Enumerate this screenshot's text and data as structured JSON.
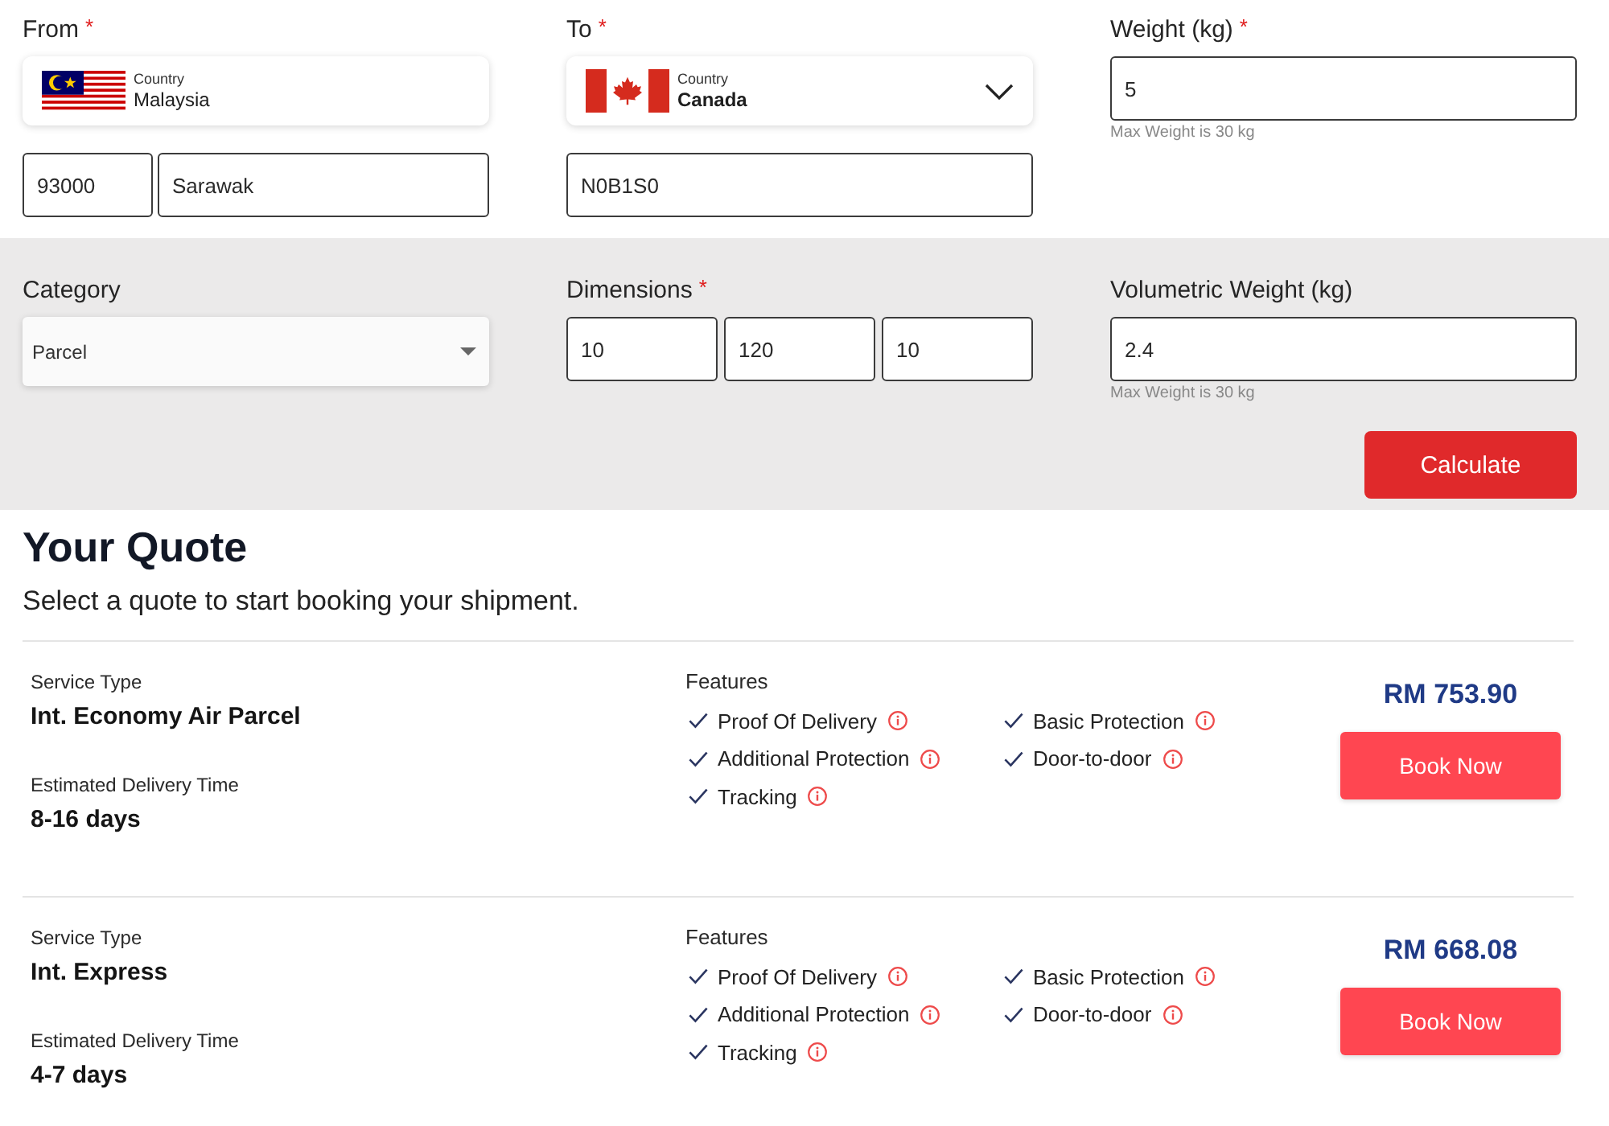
{
  "from": {
    "label": "From",
    "required_mark": "*",
    "country_caption": "Country",
    "country": "Malaysia",
    "dropdown": false,
    "postcode": "93000",
    "state": "Sarawak"
  },
  "to": {
    "label": "To",
    "required_mark": "*",
    "country_caption": "Country",
    "country": "Canada",
    "dropdown": true,
    "postcode": "N0B1S0"
  },
  "weight": {
    "label": "Weight (kg)",
    "required_mark": "*",
    "value": "5",
    "hint": "Max Weight is 30 kg"
  },
  "category": {
    "label": "Category",
    "value": "Parcel"
  },
  "dimensions": {
    "label": "Dimensions",
    "required_mark": "*",
    "values": [
      "10",
      "120",
      "10"
    ]
  },
  "volumetric_weight": {
    "label": "Volumetric Weight (kg)",
    "value": "2.4",
    "hint": "Max Weight is 30 kg"
  },
  "calculate_button": "Calculate",
  "quote": {
    "title": "Your Quote",
    "subtitle": "Select a quote to start booking your shipment.",
    "options": [
      {
        "service_type_label": "Service Type",
        "service_type": "Int. Economy Air Parcel",
        "delivery_label": "Estimated Delivery Time",
        "delivery_time": "8-16 days",
        "features_label": "Features",
        "features": [
          "Proof Of Delivery",
          "Basic Protection",
          "Additional Protection",
          "Door-to-door",
          "Tracking"
        ],
        "price": "RM 753.90",
        "button": "Book Now"
      },
      {
        "service_type_label": "Service Type",
        "service_type": "Int. Express",
        "delivery_label": "Estimated Delivery Time",
        "delivery_time": "4-7 days",
        "features_label": "Features",
        "features": [
          "Proof Of Delivery",
          "Basic Protection",
          "Additional Protection",
          "Door-to-door",
          "Tracking"
        ],
        "price": "RM 668.08",
        "button": "Book Now"
      }
    ]
  }
}
